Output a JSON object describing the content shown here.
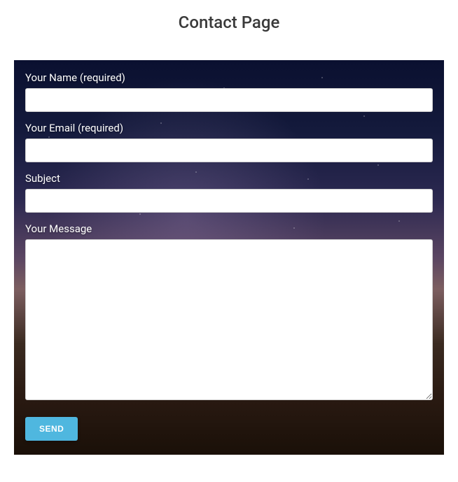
{
  "page": {
    "title": "Contact Page"
  },
  "form": {
    "name": {
      "label": "Your Name (required)",
      "value": ""
    },
    "email": {
      "label": "Your Email (required)",
      "value": ""
    },
    "subject": {
      "label": "Subject",
      "value": ""
    },
    "message": {
      "label": "Your Message",
      "value": ""
    },
    "submit_label": "SEND"
  },
  "colors": {
    "button_bg": "#4fb7df",
    "button_text": "#ffffff",
    "label_text": "#ffffff",
    "title_text": "#3a3a3a"
  }
}
